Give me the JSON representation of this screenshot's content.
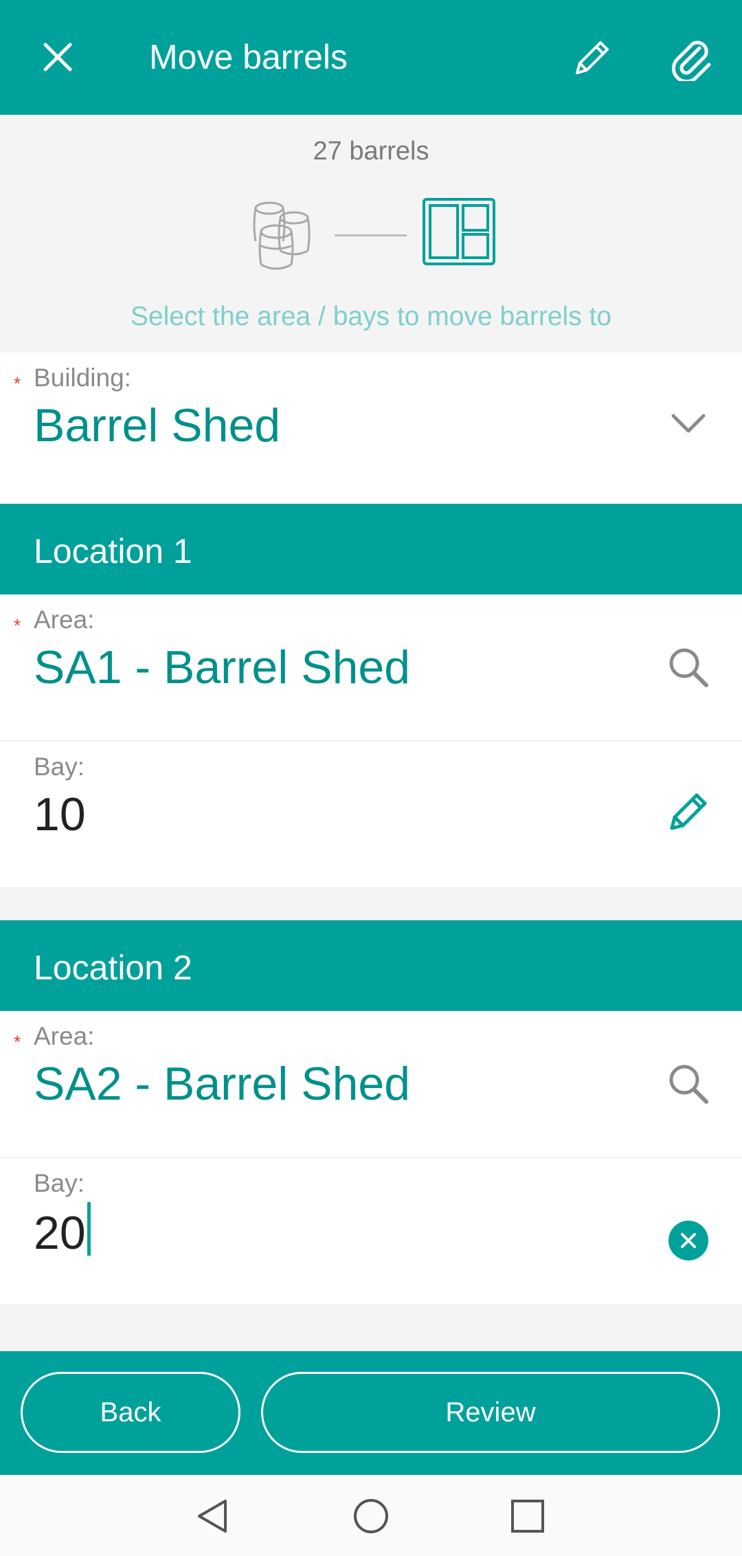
{
  "appbar": {
    "title": "Move barrels",
    "icons": {
      "close": "close-icon",
      "edit": "pencil-icon",
      "attach": "paperclip-icon"
    }
  },
  "summary": {
    "count_text": "27 barrels",
    "hint": "Select the area / bays to move barrels to"
  },
  "building": {
    "required_mark": "*",
    "label": "Building:",
    "value": "Barrel Shed"
  },
  "locations": [
    {
      "header": "Location 1",
      "area": {
        "required_mark": "*",
        "label": "Area:",
        "value": "SA1 - Barrel Shed"
      },
      "bay": {
        "label": "Bay:",
        "value": "10"
      }
    },
    {
      "header": "Location 2",
      "area": {
        "required_mark": "*",
        "label": "Area:",
        "value": "SA2 - Barrel Shed"
      },
      "bay": {
        "label": "Bay:",
        "value": "20"
      }
    }
  ],
  "footer": {
    "back_label": "Back",
    "review_label": "Review"
  },
  "colors": {
    "primary": "#00a19b",
    "value_text": "#00908b",
    "hint": "#7fcfcc",
    "required": "#e53935"
  }
}
